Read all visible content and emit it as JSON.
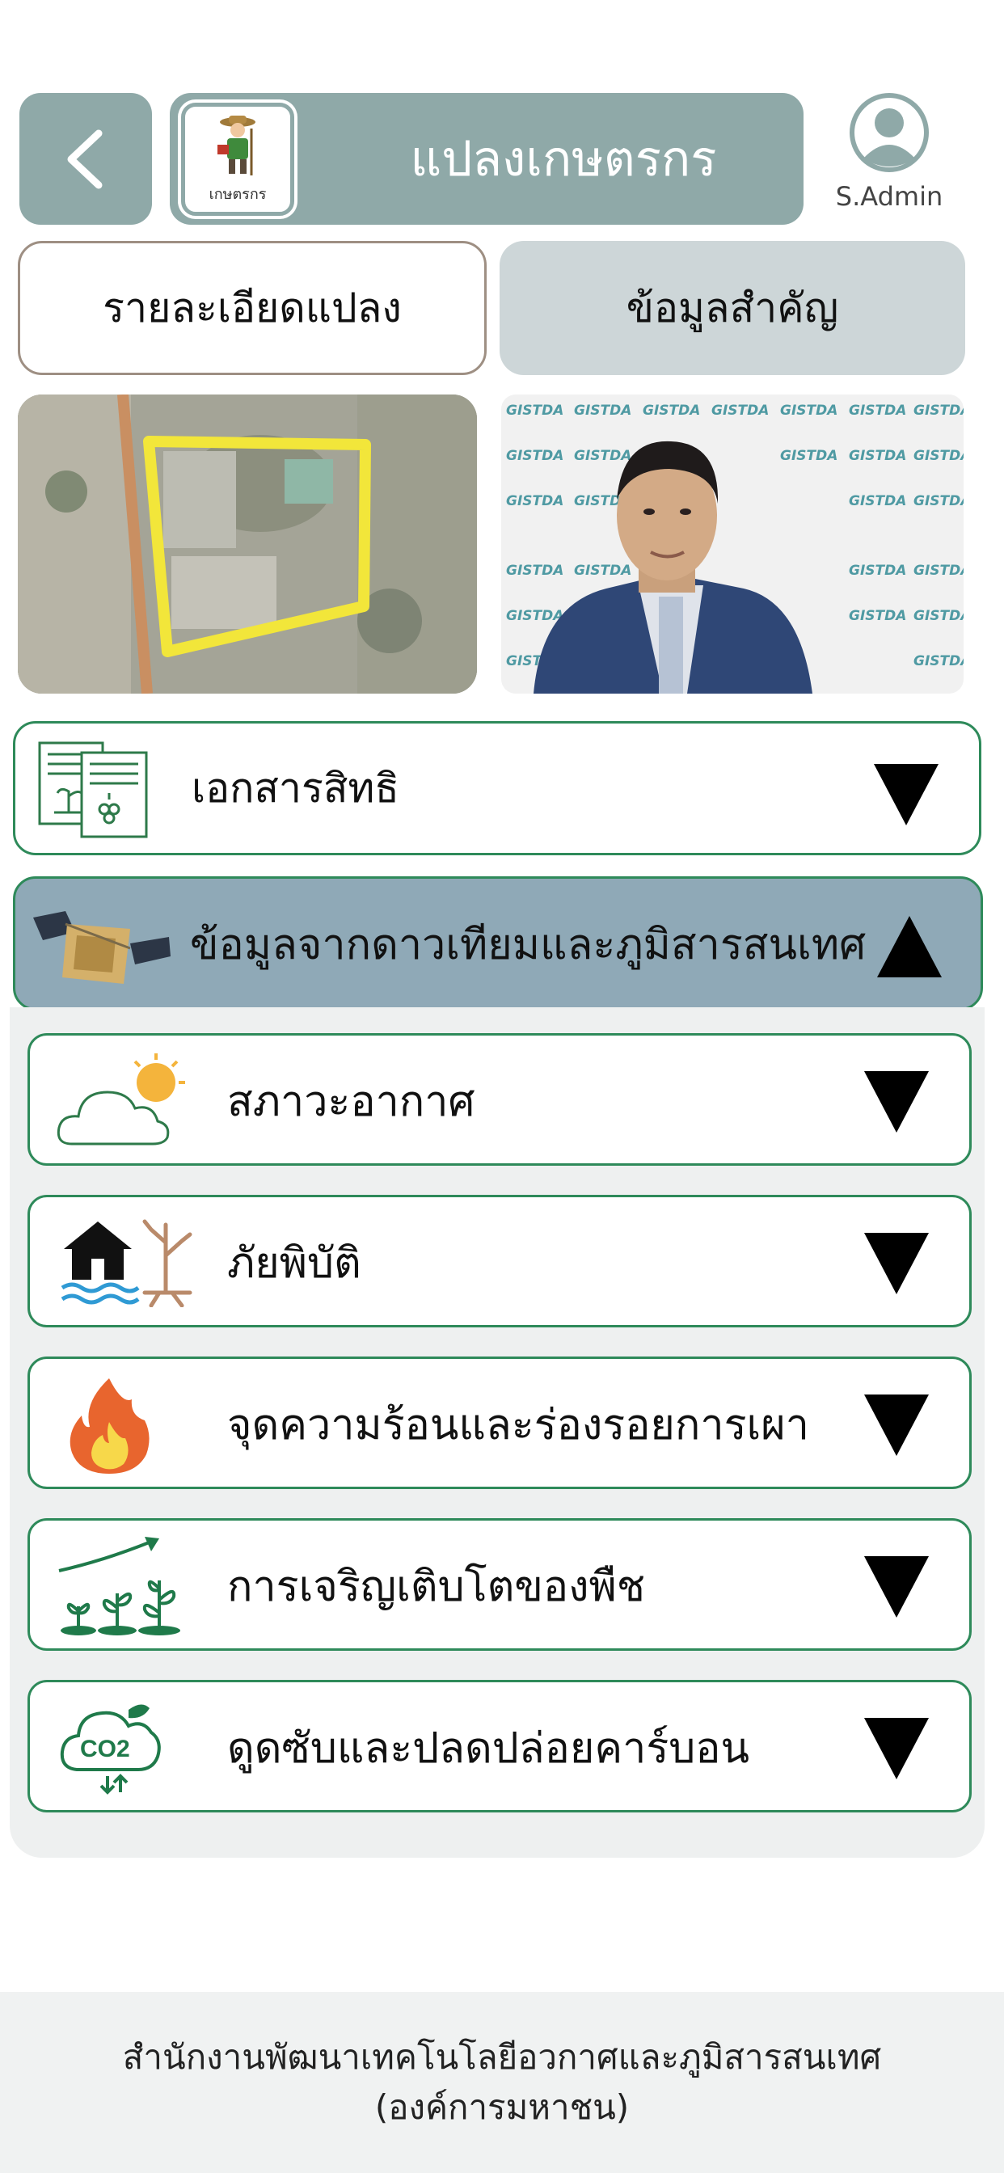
{
  "header": {
    "title": "แปลงเกษตรกร",
    "logo_label": "เกษตรกร",
    "user_label": "S.Admin"
  },
  "tabs": [
    {
      "label": "รายละเอียดแปลง"
    },
    {
      "label": "ข้อมูลสำคัญ"
    }
  ],
  "photo": {
    "watermark": "GISTDA"
  },
  "sections": {
    "documents": {
      "label": "เอกสารสิทธิ"
    },
    "satellite": {
      "label": "ข้อมูลจากดาวเทียมและภูมิสารสนเทศ"
    }
  },
  "subsections": [
    {
      "label": "สภาวะอากาศ"
    },
    {
      "label": "ภัยพิบัติ"
    },
    {
      "label": "จุดความร้อนและร่องรอยการเผา"
    },
    {
      "label": "การเจริญเติบโตของพืช"
    },
    {
      "label": "ดูดซับและปลดปล่อยคาร์บอน"
    }
  ],
  "co2_label": "CO2",
  "footer": {
    "line1": "สำนักงานพัฒนาเทคโนโลยีอวกาศและภูมิสารสนเทศ",
    "line2": "(องค์การมหาชน)"
  },
  "colors": {
    "header_bg": "#8fa9a8",
    "border_green": "#2e8a5a",
    "satellite_row_bg": "#8fa9b7",
    "tab_active_bg": "#cdd6d8"
  }
}
